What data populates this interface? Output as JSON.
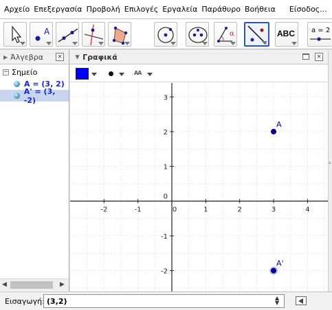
{
  "menu": [
    "Αρχείο",
    "Επεξεργασία",
    "Προβολή",
    "Επιλογές",
    "Εργαλεία",
    "Παράθυρο",
    "Βοήθεια"
  ],
  "login_label": "Είσοδος...",
  "toolbar": {
    "tools": [
      "move-icon",
      "point-icon",
      "line-icon",
      "perpendicular-line-icon",
      "polygon-icon",
      "circle-icon",
      "ellipse-icon",
      "angle-icon",
      "reflect-icon",
      "text-icon",
      "slider-icon"
    ],
    "active_tool": "reflect-icon",
    "text_tool_label": "ABC",
    "slider_tool_label": "a = 2"
  },
  "algebra": {
    "title": "Άλγεβρα",
    "category": "Σημείο",
    "items": [
      {
        "label": "A = (3, 2)",
        "selected": false
      },
      {
        "label": "A' = (3, -2)",
        "selected": true
      }
    ]
  },
  "graphics": {
    "title": "Γραφικά",
    "point_style_color": "#0000ff",
    "label_style": "AA"
  },
  "chart_data": {
    "type": "scatter",
    "xlim": [
      -3.0,
      4.6
    ],
    "ylim": [
      -2.6,
      3.4
    ],
    "x_ticks": [
      "-2",
      "-1",
      "0",
      "1",
      "2",
      "3",
      "4"
    ],
    "y_ticks": [
      "3",
      "2",
      "1",
      "0",
      "-1",
      "-2"
    ],
    "grid": true,
    "points": [
      {
        "name": "A",
        "x": 3,
        "y": 2,
        "selected": false
      },
      {
        "name": "A'",
        "x": 3,
        "y": -2,
        "selected": true
      }
    ],
    "point_color": "#0000aa"
  },
  "input_bar": {
    "label": "Εισαγωγή:",
    "value": "(3,2)"
  }
}
